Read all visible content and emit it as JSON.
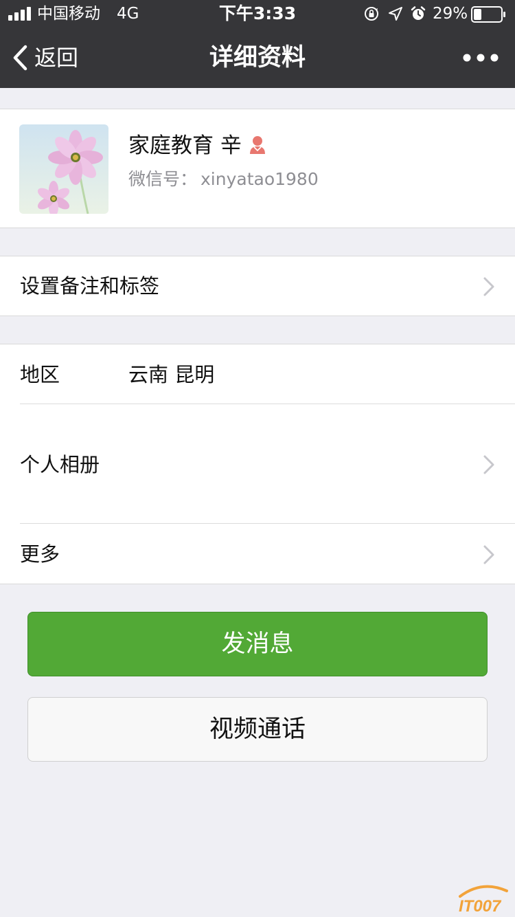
{
  "status_bar": {
    "carrier": "中国移动",
    "network": "4G",
    "time": "下午3:33",
    "battery": "29%",
    "battery_level": 0.29,
    "icons": [
      "signal-icon",
      "orientation-lock-icon",
      "location-arrow-icon",
      "alarm-icon",
      "battery-icon"
    ]
  },
  "nav": {
    "back_label": "返回",
    "title": "详细资料",
    "more_icon": "more-dots-icon"
  },
  "profile": {
    "name": "家庭教育 辛",
    "gender_icon": "female-icon",
    "gender_color": "#e8776f",
    "wechat_id_label": "微信号：",
    "wechat_id": "xinyatao1980"
  },
  "remark": {
    "label": "设置备注和标签"
  },
  "info": {
    "region_label": "地区",
    "region_value": "云南 昆明",
    "album_label": "个人相册",
    "more_label": "更多"
  },
  "actions": {
    "send_message": "发消息",
    "video_call": "视频通话"
  },
  "colors": {
    "header_bg": "#363639",
    "page_bg": "#efeff4",
    "primary_green": "#52a936"
  },
  "watermark": {
    "text": "IT007"
  }
}
